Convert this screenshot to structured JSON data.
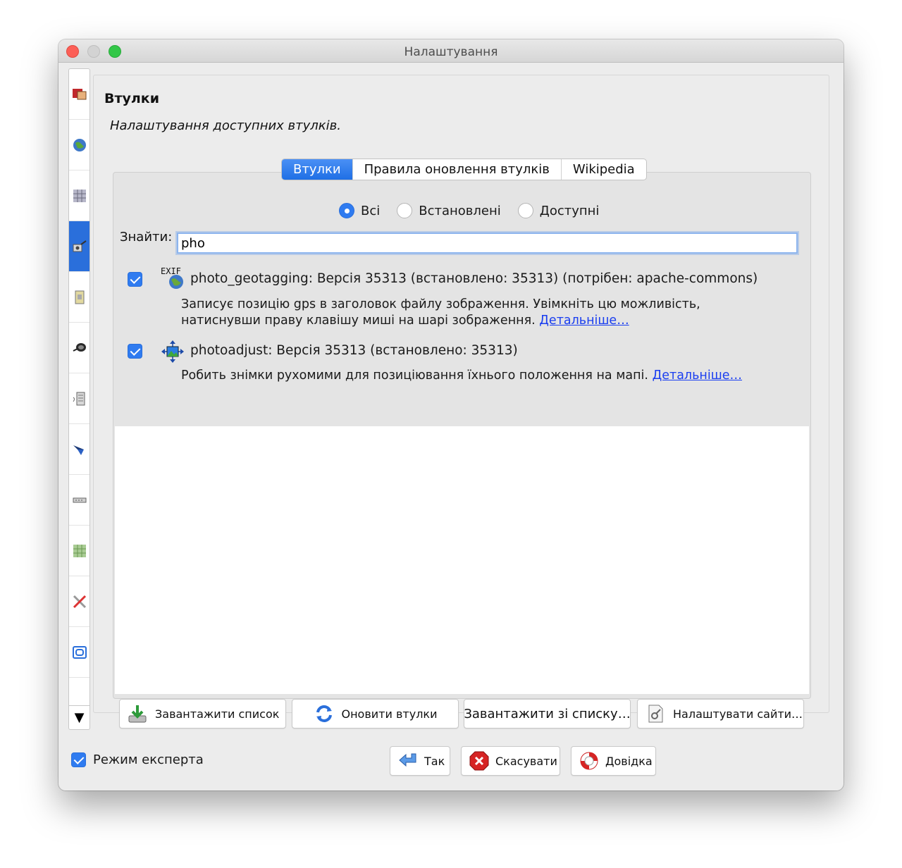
{
  "window": {
    "title": "Налаштування"
  },
  "sidebar": {
    "items": [
      {
        "icon": "display-icon"
      },
      {
        "icon": "globe-icon"
      },
      {
        "icon": "map-grid-icon"
      },
      {
        "icon": "plugin-icon",
        "active": true
      },
      {
        "icon": "map-paint-icon"
      },
      {
        "icon": "projection-icon"
      },
      {
        "icon": "presets-icon"
      },
      {
        "icon": "remote-control-icon"
      },
      {
        "icon": "shortcut-icon"
      },
      {
        "icon": "validator-icon"
      },
      {
        "icon": "tools-icon"
      },
      {
        "icon": "imagery-icon"
      }
    ],
    "more_arrow": "▼"
  },
  "main": {
    "title": "Втулки",
    "subtitle": "Налаштування доступних втулків.",
    "tabs": [
      {
        "label": "Втулки",
        "active": true
      },
      {
        "label": "Правила оновлення втулків",
        "active": false
      },
      {
        "label": "Wikipedia",
        "active": false
      }
    ],
    "filters": [
      {
        "label": "Всі",
        "selected": true
      },
      {
        "label": "Встановлені",
        "selected": false
      },
      {
        "label": "Доступні",
        "selected": false
      }
    ],
    "search": {
      "label": "Знайти:",
      "value": "pho"
    },
    "plugins": [
      {
        "icon_badge": "EXIF",
        "title": "photo_geotagging: Версія 35313 (встановлено: 35313) (потрібен: apache-commons)",
        "desc_line1": "Записує позицію gps в заголовок файлу зображення. Увімкніть цю можливість,",
        "desc_line2": "натиснувши праву клавішу миші на шарі зображення.",
        "more": "Детальніше…",
        "checked": true
      },
      {
        "title": "photoadjust: Версія 35313 (встановлено: 35313)",
        "desc_line1": "Робить знімки рухомими для позиціювання їхнього положення на мапі.",
        "more": "Детальніше…",
        "checked": true
      }
    ],
    "buttons": {
      "download_list": "Завантажити список",
      "update_plugins": "Оновити втулки",
      "download_from_list": "Завантажити зі списку…",
      "configure_sites": "Налаштувати сайти…"
    }
  },
  "footer": {
    "expert_mode": {
      "label": "Режим експерта",
      "checked": true
    },
    "ok": "Так",
    "cancel": "Скасувати",
    "help": "Довідка"
  },
  "colors": {
    "accent": "#2f7bf0",
    "link": "#1a3ef0",
    "close": "#fc5f57",
    "maximize": "#33c748"
  }
}
